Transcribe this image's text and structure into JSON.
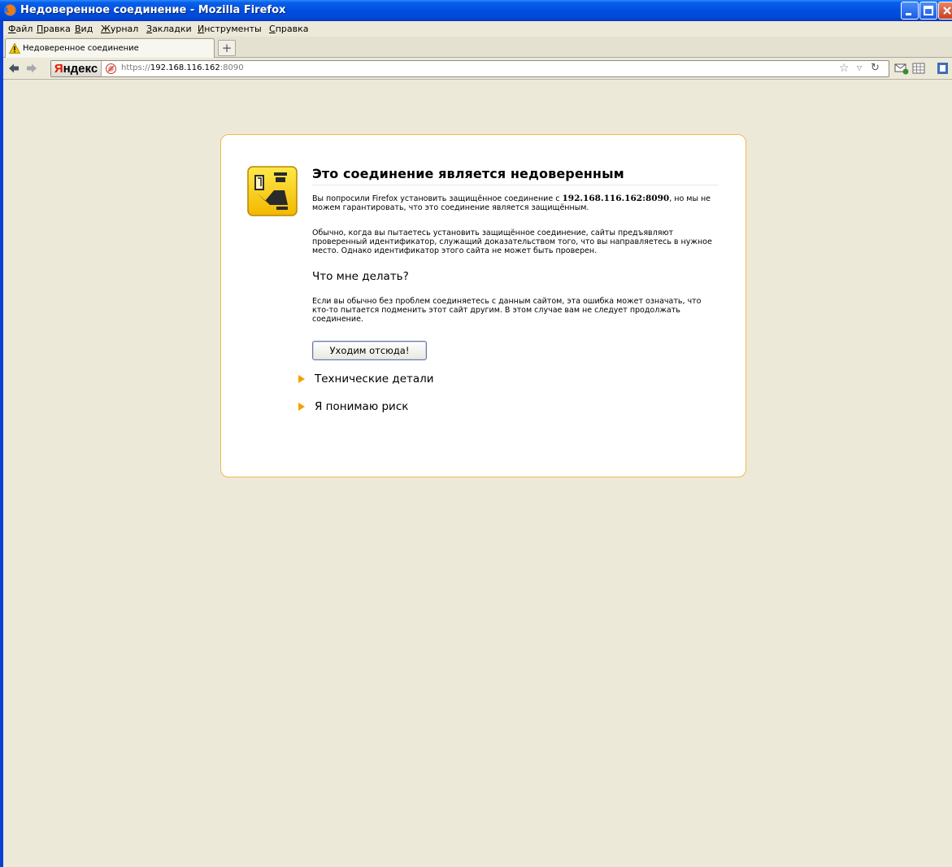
{
  "window": {
    "title": "Недоверенное соединение - Mozilla Firefox"
  },
  "menubar": {
    "items": [
      {
        "label_first": "Ф",
        "label_rest": "айл"
      },
      {
        "label_first": "П",
        "label_rest": "равка"
      },
      {
        "label_first": "В",
        "label_rest": "ид"
      },
      {
        "label_first": "Ж",
        "label_rest": "урнал"
      },
      {
        "label_first": "З",
        "label_rest": "акладки"
      },
      {
        "label_first": "И",
        "label_rest": "нструменты"
      },
      {
        "label_first": "С",
        "label_rest": "правка"
      }
    ]
  },
  "tabs": [
    {
      "label": "Недоверенное соединение",
      "icon": "warning-icon"
    }
  ],
  "newtab_label": "+",
  "navbar": {
    "yandex_first": "Я",
    "yandex_rest": "ндекс",
    "url_scheme": "https://",
    "url_host": "192.168.116.162",
    "url_port": ":8090"
  },
  "error": {
    "title": "Это соединение является недоверенным",
    "p1_before": "Вы попросили Firefox установить защищённое соединение с ",
    "p1_host": "192.168.116.162:8090",
    "p1_after": ", но мы не можем гарантировать, что это соединение является защищённым.",
    "p2": "Обычно, когда вы пытаетесь установить защищённое соединение, сайты предъявляют проверенный идентификатор, служащий доказательством того, что вы направляетесь в нужное место. Однако идентификатор этого сайта не может быть проверен.",
    "what_heading": "Что мне делать?",
    "p3": "Если вы обычно без проблем соединяетесь с данным сайтом, эта ошибка может означать, что кто-то пытается подменить этот сайт другим. В этом случае вам не следует продолжать соединение.",
    "getout_button": "Уходим отсюда!",
    "technical_details": "Технические детали",
    "understand_risk": "Я понимаю риск"
  },
  "colors": {
    "xp_titlebar": "#0050e0",
    "chrome_bg": "#ece9d8",
    "box_border": "#f2b94a",
    "expander_arrow": "#f2a200",
    "yandex_red": "#e61400"
  }
}
